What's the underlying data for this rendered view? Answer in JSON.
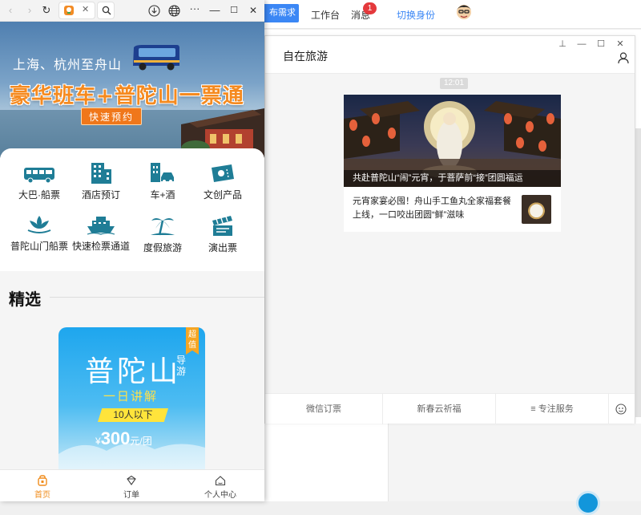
{
  "top_nav": {
    "publish_label": "布需求",
    "workbench": "工作台",
    "messages": "消息",
    "message_badge": "1",
    "switch_identity": "切换身份"
  },
  "chat": {
    "title": "自在旅游",
    "time": "12:01",
    "card_title": "共赴普陀山“闹”元宵，于菩萨前“接”团圆福运",
    "card_sub": "元宵家宴必囤！舟山手工鱼丸全家福套餐上线，一口咬出团圆“鲜”滋味",
    "footer": [
      "微信订票",
      "新春云祈福",
      "专注服务"
    ]
  },
  "banner": {
    "subtitle": "上海、杭州至舟山",
    "title": "豪华班车+普陀山一票通",
    "cta": "快速预约"
  },
  "grid": [
    {
      "label": "大巴·船票",
      "icon": "bus-icon"
    },
    {
      "label": "酒店预订",
      "icon": "hotel-icon"
    },
    {
      "label": "车+酒",
      "icon": "car-hotel-icon"
    },
    {
      "label": "文创产品",
      "icon": "ticket-icon"
    },
    {
      "label": "普陀山门船票",
      "icon": "lotus-icon"
    },
    {
      "label": "快速检票通道",
      "icon": "ship-icon"
    },
    {
      "label": "度假旅游",
      "icon": "palm-icon"
    },
    {
      "label": "演出票",
      "icon": "clapper-icon"
    }
  ],
  "featured": {
    "title": "精选",
    "promo_title": "普陀山",
    "promo_guide": "导游",
    "promo_oneday": "一日讲解",
    "promo_ribbon": "10人以下",
    "promo_currency": "¥",
    "promo_price": "300",
    "promo_unit": "元/团",
    "promo_tag": "超值"
  },
  "tabbar": {
    "home": "首页",
    "orders": "订单",
    "profile": "个人中心"
  },
  "colors": {
    "accent_blue": "#3b87f5",
    "brand_teal": "#1f7d96",
    "active_orange": "#f08c1b"
  }
}
